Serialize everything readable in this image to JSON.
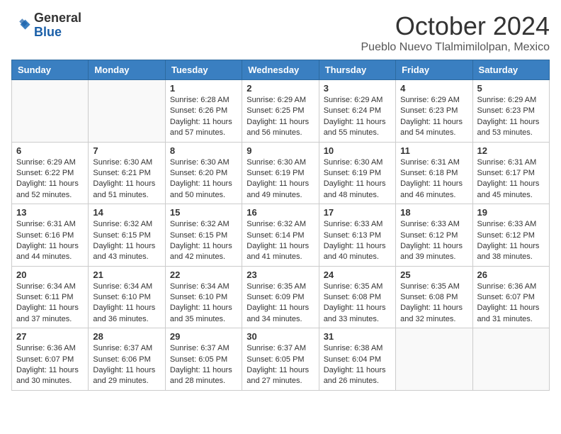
{
  "header": {
    "logo_general": "General",
    "logo_blue": "Blue",
    "month_title": "October 2024",
    "location": "Pueblo Nuevo Tlalmimilolpan, Mexico"
  },
  "weekdays": [
    "Sunday",
    "Monday",
    "Tuesday",
    "Wednesday",
    "Thursday",
    "Friday",
    "Saturday"
  ],
  "weeks": [
    [
      {
        "day": "",
        "info": ""
      },
      {
        "day": "",
        "info": ""
      },
      {
        "day": "1",
        "info": "Sunrise: 6:28 AM\nSunset: 6:26 PM\nDaylight: 11 hours and 57 minutes."
      },
      {
        "day": "2",
        "info": "Sunrise: 6:29 AM\nSunset: 6:25 PM\nDaylight: 11 hours and 56 minutes."
      },
      {
        "day": "3",
        "info": "Sunrise: 6:29 AM\nSunset: 6:24 PM\nDaylight: 11 hours and 55 minutes."
      },
      {
        "day": "4",
        "info": "Sunrise: 6:29 AM\nSunset: 6:23 PM\nDaylight: 11 hours and 54 minutes."
      },
      {
        "day": "5",
        "info": "Sunrise: 6:29 AM\nSunset: 6:23 PM\nDaylight: 11 hours and 53 minutes."
      }
    ],
    [
      {
        "day": "6",
        "info": "Sunrise: 6:29 AM\nSunset: 6:22 PM\nDaylight: 11 hours and 52 minutes."
      },
      {
        "day": "7",
        "info": "Sunrise: 6:30 AM\nSunset: 6:21 PM\nDaylight: 11 hours and 51 minutes."
      },
      {
        "day": "8",
        "info": "Sunrise: 6:30 AM\nSunset: 6:20 PM\nDaylight: 11 hours and 50 minutes."
      },
      {
        "day": "9",
        "info": "Sunrise: 6:30 AM\nSunset: 6:19 PM\nDaylight: 11 hours and 49 minutes."
      },
      {
        "day": "10",
        "info": "Sunrise: 6:30 AM\nSunset: 6:19 PM\nDaylight: 11 hours and 48 minutes."
      },
      {
        "day": "11",
        "info": "Sunrise: 6:31 AM\nSunset: 6:18 PM\nDaylight: 11 hours and 46 minutes."
      },
      {
        "day": "12",
        "info": "Sunrise: 6:31 AM\nSunset: 6:17 PM\nDaylight: 11 hours and 45 minutes."
      }
    ],
    [
      {
        "day": "13",
        "info": "Sunrise: 6:31 AM\nSunset: 6:16 PM\nDaylight: 11 hours and 44 minutes."
      },
      {
        "day": "14",
        "info": "Sunrise: 6:32 AM\nSunset: 6:15 PM\nDaylight: 11 hours and 43 minutes."
      },
      {
        "day": "15",
        "info": "Sunrise: 6:32 AM\nSunset: 6:15 PM\nDaylight: 11 hours and 42 minutes."
      },
      {
        "day": "16",
        "info": "Sunrise: 6:32 AM\nSunset: 6:14 PM\nDaylight: 11 hours and 41 minutes."
      },
      {
        "day": "17",
        "info": "Sunrise: 6:33 AM\nSunset: 6:13 PM\nDaylight: 11 hours and 40 minutes."
      },
      {
        "day": "18",
        "info": "Sunrise: 6:33 AM\nSunset: 6:12 PM\nDaylight: 11 hours and 39 minutes."
      },
      {
        "day": "19",
        "info": "Sunrise: 6:33 AM\nSunset: 6:12 PM\nDaylight: 11 hours and 38 minutes."
      }
    ],
    [
      {
        "day": "20",
        "info": "Sunrise: 6:34 AM\nSunset: 6:11 PM\nDaylight: 11 hours and 37 minutes."
      },
      {
        "day": "21",
        "info": "Sunrise: 6:34 AM\nSunset: 6:10 PM\nDaylight: 11 hours and 36 minutes."
      },
      {
        "day": "22",
        "info": "Sunrise: 6:34 AM\nSunset: 6:10 PM\nDaylight: 11 hours and 35 minutes."
      },
      {
        "day": "23",
        "info": "Sunrise: 6:35 AM\nSunset: 6:09 PM\nDaylight: 11 hours and 34 minutes."
      },
      {
        "day": "24",
        "info": "Sunrise: 6:35 AM\nSunset: 6:08 PM\nDaylight: 11 hours and 33 minutes."
      },
      {
        "day": "25",
        "info": "Sunrise: 6:35 AM\nSunset: 6:08 PM\nDaylight: 11 hours and 32 minutes."
      },
      {
        "day": "26",
        "info": "Sunrise: 6:36 AM\nSunset: 6:07 PM\nDaylight: 11 hours and 31 minutes."
      }
    ],
    [
      {
        "day": "27",
        "info": "Sunrise: 6:36 AM\nSunset: 6:07 PM\nDaylight: 11 hours and 30 minutes."
      },
      {
        "day": "28",
        "info": "Sunrise: 6:37 AM\nSunset: 6:06 PM\nDaylight: 11 hours and 29 minutes."
      },
      {
        "day": "29",
        "info": "Sunrise: 6:37 AM\nSunset: 6:05 PM\nDaylight: 11 hours and 28 minutes."
      },
      {
        "day": "30",
        "info": "Sunrise: 6:37 AM\nSunset: 6:05 PM\nDaylight: 11 hours and 27 minutes."
      },
      {
        "day": "31",
        "info": "Sunrise: 6:38 AM\nSunset: 6:04 PM\nDaylight: 11 hours and 26 minutes."
      },
      {
        "day": "",
        "info": ""
      },
      {
        "day": "",
        "info": ""
      }
    ]
  ]
}
